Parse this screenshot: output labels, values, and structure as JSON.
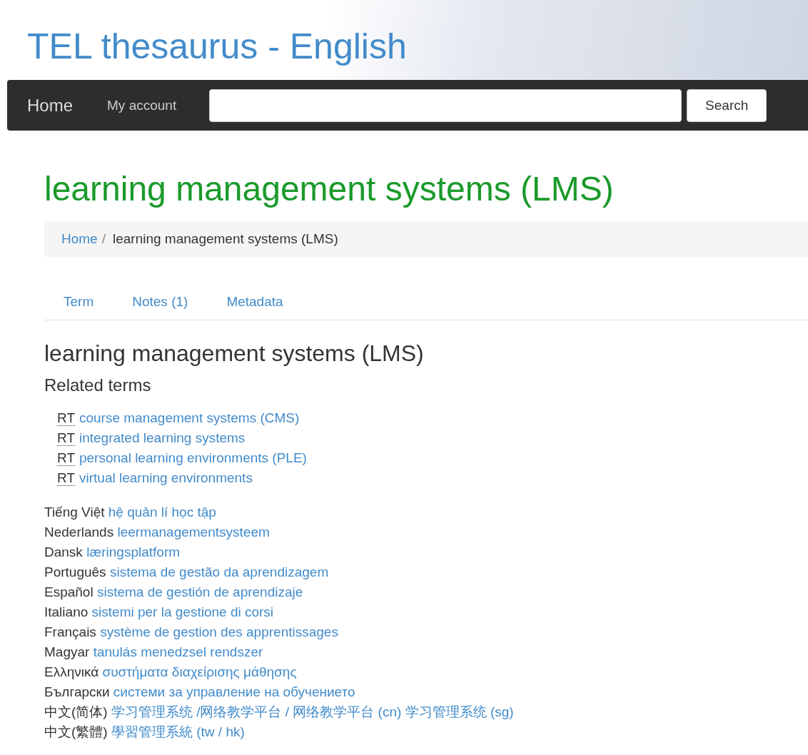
{
  "header": {
    "title": "TEL thesaurus - English"
  },
  "navbar": {
    "brand": "Home",
    "links": [
      "My account"
    ],
    "search": {
      "button": "Search"
    }
  },
  "page_title": "learning management systems (LMS)",
  "breadcrumb": {
    "items": [
      "Home"
    ],
    "separator": "/",
    "current": "learning management systems (LMS)"
  },
  "tabs": [
    {
      "label": "Term",
      "selected": false
    },
    {
      "label": "Notes (1)",
      "selected": false
    },
    {
      "label": "Metadata",
      "selected": false
    }
  ],
  "term": {
    "heading": "learning management systems (LMS)",
    "related_heading": "Related terms",
    "related": [
      {
        "abbr": "RT",
        "label": "course management systems (CMS)"
      },
      {
        "abbr": "RT",
        "label": "integrated learning systems"
      },
      {
        "abbr": "RT",
        "label": "personal learning environments (PLE)"
      },
      {
        "abbr": "RT",
        "label": "virtual learning environments"
      }
    ],
    "translations": [
      {
        "language": "Tiếng Việt",
        "term": "hệ quản lí học tập"
      },
      {
        "language": "Nederlands",
        "term": "leermanagementsysteem"
      },
      {
        "language": "Dansk",
        "term": "læringsplatform"
      },
      {
        "language": "Português",
        "term": "sistema de gestão da aprendizagem"
      },
      {
        "language": "Español",
        "term": "sistema de gestión de aprendizaje"
      },
      {
        "language": "Italiano",
        "term": "sistemi per la gestione di corsi"
      },
      {
        "language": "Français",
        "term": "système de gestion des apprentissages"
      },
      {
        "language": "Magyar",
        "term": "tanulás menedzsel rendszer"
      },
      {
        "language": "Ελληνικά",
        "term": "συστήματα διαχείρισης μάθησης"
      },
      {
        "language": "Български",
        "term": "системи за управление на обучението"
      },
      {
        "language": "中文(简体)",
        "term": "学习管理系统 /网络教学平台 / 网络教学平台 (cn) 学习管理系统 (sg)"
      },
      {
        "language": "中文(繁體)",
        "term": "學習管理系統 (tw / hk)"
      }
    ]
  }
}
